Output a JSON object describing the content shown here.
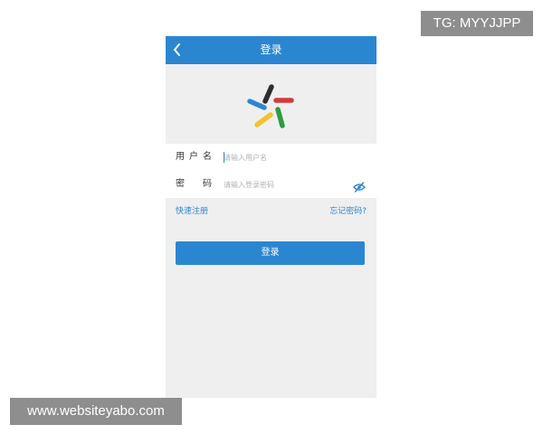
{
  "watermarks": {
    "top": "TG: MYYJJPP",
    "bottom": "www.websiteyabo.com"
  },
  "header": {
    "title": "登录",
    "back_icon": "chevron-left-icon"
  },
  "logo": {
    "icon": "star-logo-icon",
    "colors": [
      "#2e2e2e",
      "#d23a3a",
      "#2e9b45",
      "#f2c230",
      "#2b86d2"
    ]
  },
  "form": {
    "username": {
      "label_chars": [
        "用",
        "户",
        "名"
      ],
      "placeholder": "请输入用户名",
      "value": ""
    },
    "password": {
      "label_chars": [
        "密",
        "码"
      ],
      "placeholder": "请输入登录密码",
      "value": "",
      "toggle_icon": "eye-slash-icon"
    }
  },
  "links": {
    "register": "快速注册",
    "forgot": "忘记密码?"
  },
  "login_button": "登录",
  "colors": {
    "primary": "#2b86d2",
    "background": "#efefef",
    "field_background": "#ffffff"
  }
}
